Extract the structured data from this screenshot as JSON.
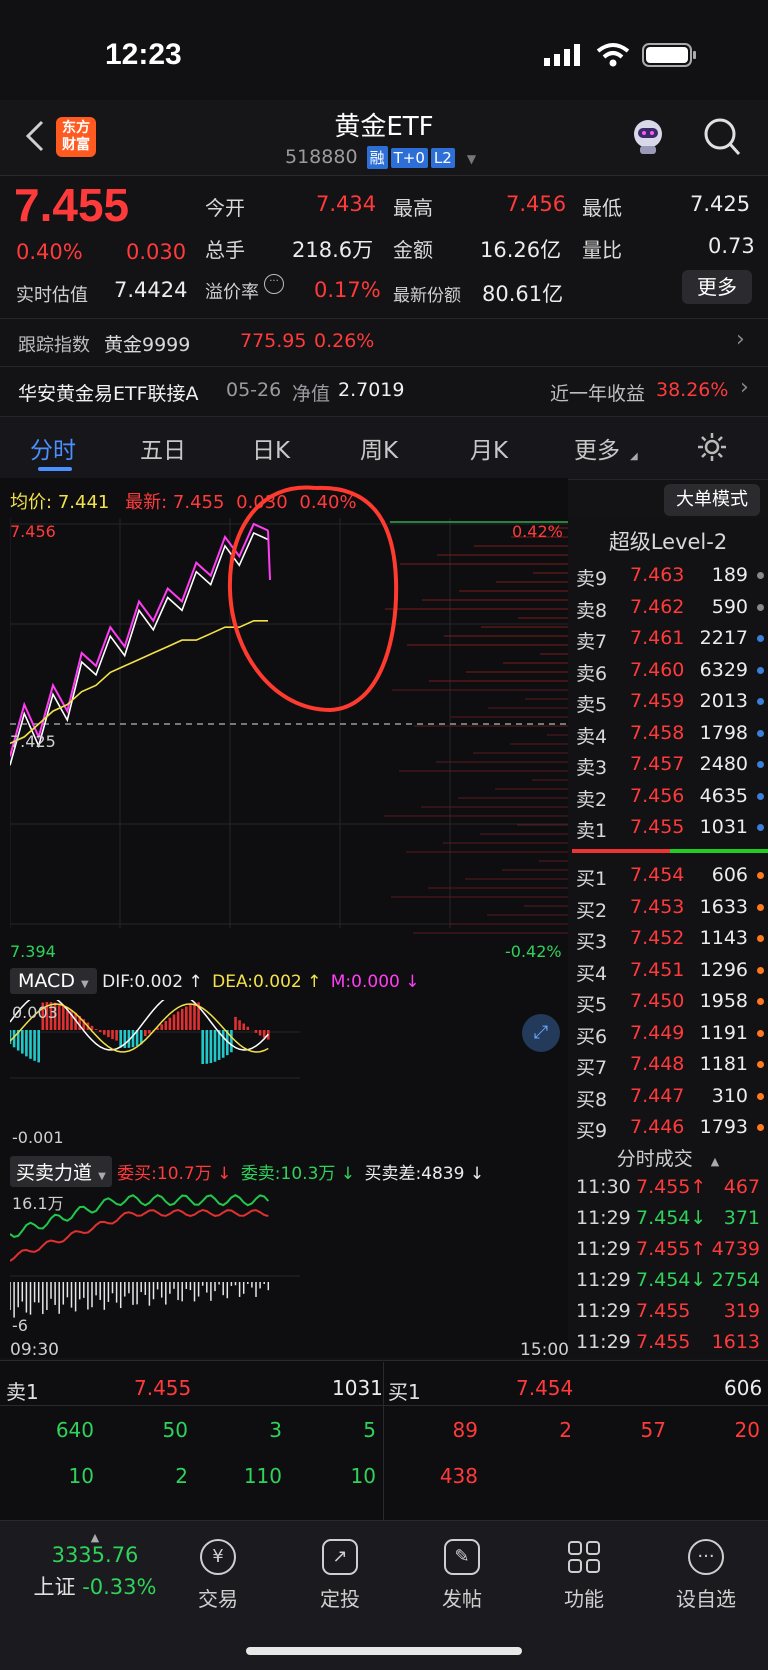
{
  "status_bar": {
    "time": "12:23"
  },
  "header": {
    "logo_text": "东方\n财富",
    "title": "黄金ETF",
    "code": "518880",
    "tags": [
      "融",
      "T+0",
      "L2"
    ]
  },
  "quote": {
    "price": "7.455",
    "change_pct": "0.40%",
    "change": "0.030",
    "est_label": "实时估值",
    "est_value": "7.4424",
    "open_label": "今开",
    "open": "7.434",
    "high_label": "最高",
    "high": "7.456",
    "low_label": "最低",
    "low": "7.425",
    "vol_label": "总手",
    "vol": "218.6万",
    "amount_label": "金额",
    "amount": "16.26亿",
    "ratio_label": "量比",
    "ratio": "0.73",
    "premium_label": "溢价率",
    "premium": "0.17%",
    "shares_label": "最新份额",
    "shares": "80.61亿",
    "more_button": "更多"
  },
  "tracking": {
    "label": "跟踪指数",
    "name": "黄金9999",
    "value": "775.95",
    "pct": "0.26%"
  },
  "linked_fund": {
    "name": "华安黄金易ETF联接A",
    "date": "05-26",
    "nav_label": "净值",
    "nav": "2.7019",
    "return_label": "近一年收益",
    "return": "38.26%"
  },
  "tabs": [
    "分时",
    "五日",
    "日K",
    "周K",
    "月K",
    "更多"
  ],
  "chart_header": {
    "avg_label": "均价:",
    "avg": "7.441",
    "latest_label": "最新:",
    "latest": "7.455",
    "change": "0.030",
    "pct": "0.40%",
    "big_order_button": "大单模式"
  },
  "chart_axis": {
    "top_price": "7.456",
    "mid_price": "7.425",
    "bottom_price": "7.394",
    "top_pct": "0.42%",
    "bottom_pct": "-0.42%",
    "start_time": "09:30",
    "end_time": "15:00"
  },
  "macd": {
    "selector": "MACD",
    "dif": "DIF:0.002 ↑",
    "dea": "DEA:0.002 ↑",
    "m": "M:0.000 ↓",
    "top": "0.003",
    "bottom": "-0.001"
  },
  "force": {
    "selector": "买卖力道",
    "buy": "委买:10.7万 ↓",
    "sell": "委卖:10.3万 ↓",
    "diff": "买卖差:4839 ↓",
    "top": "16.1万",
    "bottom": "-6"
  },
  "chart_data": {
    "type": "line",
    "x_range": [
      "09:30",
      "15:00"
    ],
    "ylim": [
      7.394,
      7.456
    ],
    "prev_close": 7.425,
    "series": [
      {
        "name": "最新",
        "values": [
          7.42,
          7.428,
          7.423,
          7.431,
          7.427,
          7.436,
          7.434,
          7.44,
          7.437,
          7.444,
          7.441,
          7.446,
          7.444,
          7.45,
          7.448,
          7.454,
          7.451,
          7.456,
          7.455
        ]
      },
      {
        "name": "均价",
        "values": [
          7.422,
          7.423,
          7.425,
          7.427,
          7.428,
          7.43,
          7.431,
          7.433,
          7.434,
          7.435,
          7.436,
          7.437,
          7.438,
          7.438,
          7.439,
          7.44,
          7.44,
          7.441,
          7.441
        ]
      }
    ]
  },
  "level2": {
    "title": "超级Level-2",
    "asks": [
      {
        "label": "卖9",
        "price": "7.463",
        "vol": "189",
        "dot": "#888888"
      },
      {
        "label": "卖8",
        "price": "7.462",
        "vol": "590",
        "dot": "#888888"
      },
      {
        "label": "卖7",
        "price": "7.461",
        "vol": "2217",
        "dot": "#3b7fd9"
      },
      {
        "label": "卖6",
        "price": "7.460",
        "vol": "6329",
        "dot": "#3b7fd9"
      },
      {
        "label": "卖5",
        "price": "7.459",
        "vol": "2013",
        "dot": "#3b7fd9"
      },
      {
        "label": "卖4",
        "price": "7.458",
        "vol": "1798",
        "dot": "#3b7fd9"
      },
      {
        "label": "卖3",
        "price": "7.457",
        "vol": "2480",
        "dot": "#3b7fd9"
      },
      {
        "label": "卖2",
        "price": "7.456",
        "vol": "4635",
        "dot": "#3b7fd9"
      },
      {
        "label": "卖1",
        "price": "7.455",
        "vol": "1031",
        "dot": "#3b7fd9"
      }
    ],
    "bids": [
      {
        "label": "买1",
        "price": "7.454",
        "vol": "606",
        "dot": "#ff7a1a"
      },
      {
        "label": "买2",
        "price": "7.453",
        "vol": "1633",
        "dot": "#ff7a1a"
      },
      {
        "label": "买3",
        "price": "7.452",
        "vol": "1143",
        "dot": "#ff7a1a"
      },
      {
        "label": "买4",
        "price": "7.451",
        "vol": "1296",
        "dot": "#ff7a1a"
      },
      {
        "label": "买5",
        "price": "7.450",
        "vol": "1958",
        "dot": "#ff7a1a"
      },
      {
        "label": "买6",
        "price": "7.449",
        "vol": "1191",
        "dot": "#ff7a1a"
      },
      {
        "label": "买7",
        "price": "7.448",
        "vol": "1181",
        "dot": "#ff7a1a"
      },
      {
        "label": "买8",
        "price": "7.447",
        "vol": "310",
        "dot": "#ff7a1a"
      },
      {
        "label": "买9",
        "price": "7.446",
        "vol": "1793",
        "dot": "#ff7a1a"
      }
    ],
    "trades_title": "分时成交",
    "trades": [
      {
        "time": "11:30",
        "price": "7.455↑",
        "vol": "467",
        "color": "#ff3a3a"
      },
      {
        "time": "11:29",
        "price": "7.454↓",
        "vol": "371",
        "color": "#2fd25a"
      },
      {
        "time": "11:29",
        "price": "7.455↑",
        "vol": "4739",
        "color": "#ff3a3a"
      },
      {
        "time": "11:29",
        "price": "7.454↓",
        "vol": "2754",
        "color": "#2fd25a"
      },
      {
        "time": "11:29",
        "price": "7.455",
        "vol": "319",
        "color": "#ff3a3a"
      },
      {
        "time": "11:29",
        "price": "7.455",
        "vol": "1613",
        "color": "#ff3a3a"
      }
    ]
  },
  "bottom_book": {
    "sell_label": "卖1",
    "sell_price": "7.455",
    "sell_vol": "1031",
    "buy_label": "买1",
    "buy_price": "7.454",
    "buy_vol": "606",
    "sell_queue_row1": [
      "640",
      "50",
      "3",
      "5"
    ],
    "sell_queue_row2": [
      "10",
      "2",
      "110",
      "10"
    ],
    "buy_queue_row1": [
      "89",
      "2",
      "57",
      "20"
    ],
    "buy_queue_row2": [
      "438"
    ]
  },
  "nav": {
    "index_value": "3335.76",
    "index_name": "上证",
    "index_pct": "-0.33%",
    "items": [
      "交易",
      "定投",
      "发帖",
      "功能",
      "设自选"
    ]
  },
  "colors": {
    "up": "#ff3a3a",
    "down": "#2fd25a",
    "price_line": "#ffffff",
    "price_line2": "#ff3df2",
    "avg_line": "#f3e14a",
    "annotation": "#ff3b30"
  }
}
